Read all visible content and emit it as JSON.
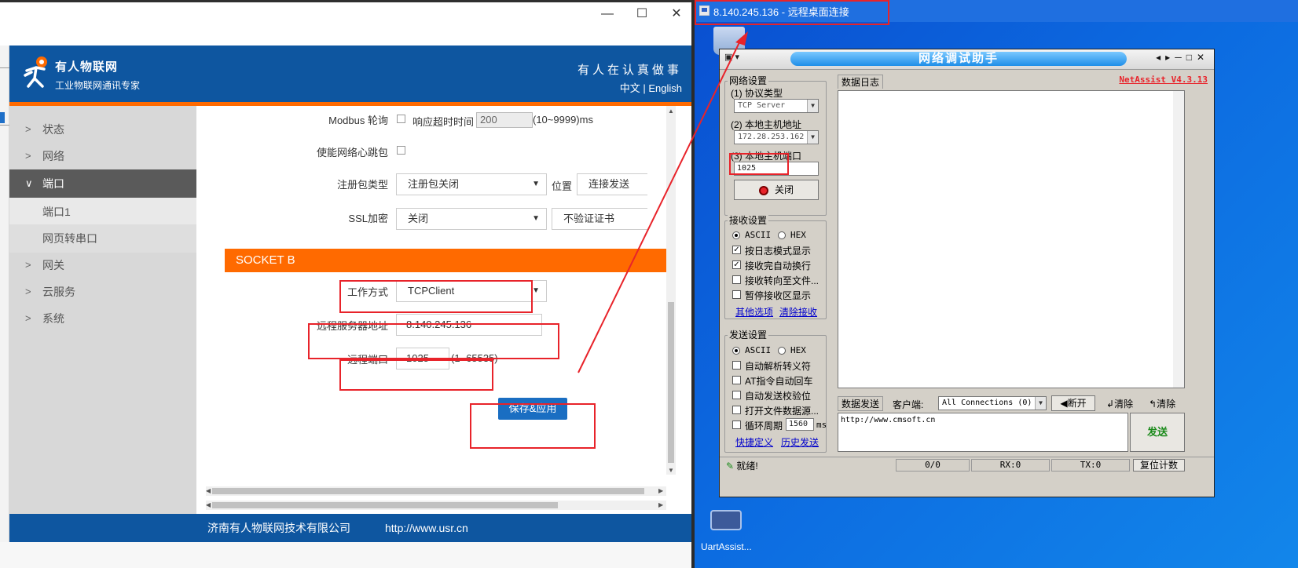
{
  "colors": {
    "usr_blue": "#0e56a0",
    "usr_orange": "#ff6a00",
    "annotation_red": "#e8232a",
    "desktop_blue": "#0c6ae0"
  },
  "left_window": {
    "controls": [
      "—",
      "☐",
      "✕"
    ],
    "header": {
      "brand": "有人物联网",
      "slogan": "工业物联网通讯专家",
      "motto": "有人在认真做事",
      "lang": "中文 | English"
    },
    "sidebar": {
      "items": [
        {
          "label": "状态",
          "icon": "chevron-right-icon"
        },
        {
          "label": "网络",
          "icon": "chevron-right-icon"
        },
        {
          "label": "端口",
          "icon": "chevron-down-icon"
        },
        {
          "label": "端口1"
        },
        {
          "label": "网页转串口"
        },
        {
          "label": "网关",
          "icon": "chevron-right-icon"
        },
        {
          "label": "云服务",
          "icon": "chevron-right-icon"
        },
        {
          "label": "系统",
          "icon": "chevron-right-icon"
        }
      ]
    },
    "form": {
      "modbus_label": "Modbus 轮询",
      "timeout_label": "响应超时时间",
      "timeout_value": "200",
      "timeout_range": "(10~9999)ms",
      "heartbeat_label": "使能网络心跳包",
      "reg_type_label": "注册包类型",
      "reg_type_value": "注册包关闭",
      "position_label": "位置",
      "position_value": "连接发送",
      "ssl_label": "SSL加密",
      "ssl_value": "关闭",
      "cert_value": "不验证证书",
      "section_title": "SOCKET B",
      "work_mode_label": "工作方式",
      "work_mode_value": "TCPClient",
      "server_label": "远程服务器地址",
      "server_value": "8.140.245.136",
      "port_label": "远程端口",
      "port_value": "1025",
      "port_range": "(1~65535)",
      "save_button": "保存&应用"
    },
    "footer": {
      "company": "济南有人物联网技术有限公司",
      "url": "http://www.usr.cn"
    }
  },
  "desktop": {
    "rdp_title": "8.140.245.136 - 远程桌面连接",
    "uart_label": "UartAssist...",
    "netassist": {
      "title": "网络调试助手",
      "version": "NetAssist V4.3.13",
      "net_settings": "网络设置",
      "protocol_label": "(1) 协议类型",
      "protocol_value": "TCP Server",
      "host_label": "(2) 本地主机地址",
      "host_value": "172.28.253.162",
      "port_label": "(3) 本地主机端口",
      "port_value": "1025",
      "close_button": "关闭",
      "recv_settings": "接收设置",
      "ascii": "ASCII",
      "hex": "HEX",
      "recv_opts": [
        "按日志模式显示",
        "接收完自动换行",
        "接收转向至文件...",
        "暂停接收区显示"
      ],
      "recv_checked": [
        true,
        true,
        false,
        false
      ],
      "more_options": "其他选项",
      "clear_recv": "清除接收",
      "send_settings": "发送设置",
      "send_opts": [
        "自动解析转义符",
        "AT指令自动回车",
        "自动发送校验位",
        "打开文件数据源...",
        "循环周期"
      ],
      "cycle_value": "1560",
      "cycle_unit": "ms",
      "shortcut": "快捷定义",
      "history": "历史发送",
      "log_tab": "数据日志",
      "send_tab": "数据发送",
      "client_label": "客户端:",
      "client_value": "All Connections (0)",
      "disconnect": "断开",
      "clear1": "清除",
      "clear2": "清除",
      "send_text": "http://www.cmsoft.cn",
      "send_button": "发送",
      "status_ready": "就绪!",
      "count": "0/0",
      "rx": "RX:0",
      "tx": "TX:0",
      "reset": "复位计数"
    }
  }
}
